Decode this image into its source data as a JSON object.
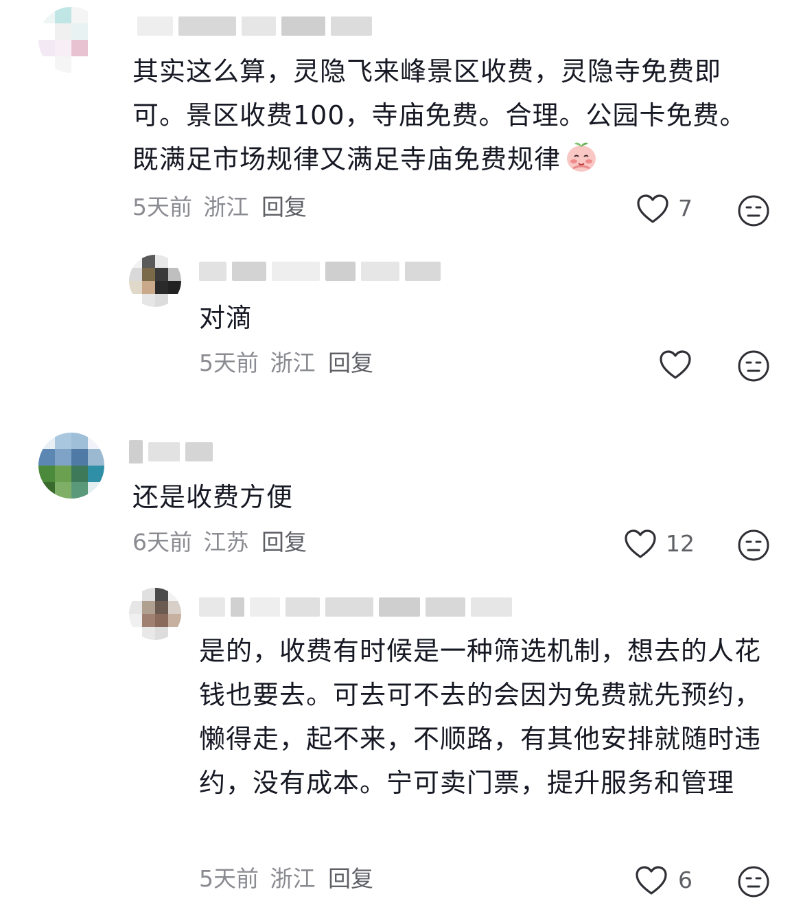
{
  "comments": [
    {
      "text": "其实这么算，灵隐飞来峰景区收费，灵隐寺免费即可。景区收费100，寺庙免费。合理。公园卡免费。既满足市场规律又满足寺庙免费规律",
      "emoji_icon": "blushing-peach-emoji-icon",
      "time": "5天前",
      "location": "浙江",
      "reply_label": "回复",
      "likes": "7",
      "replies": [
        {
          "text": "对滴",
          "time": "5天前",
          "location": "浙江",
          "reply_label": "回复",
          "likes": ""
        }
      ]
    },
    {
      "text": "还是收费方便",
      "time": "6天前",
      "location": "江苏",
      "reply_label": "回复",
      "likes": "12",
      "replies": [
        {
          "text": "是的，收费有时候是一种筛选机制，想去的人花钱也要去。可去可不去的会因为免费就先预约，懒得走，起不来，不顺路，有其他安排就随时违约，没有成本。宁可卖门票，提升服务和管理",
          "time": "5天前",
          "location": "浙江",
          "reply_label": "回复",
          "likes": "6"
        }
      ]
    }
  ],
  "icons": {
    "like": "heart-outline-icon",
    "dislike": "neutral-face-icon"
  },
  "colors": {
    "text": "#161823",
    "meta": "#8a8b91",
    "icon": "#2f3035"
  }
}
